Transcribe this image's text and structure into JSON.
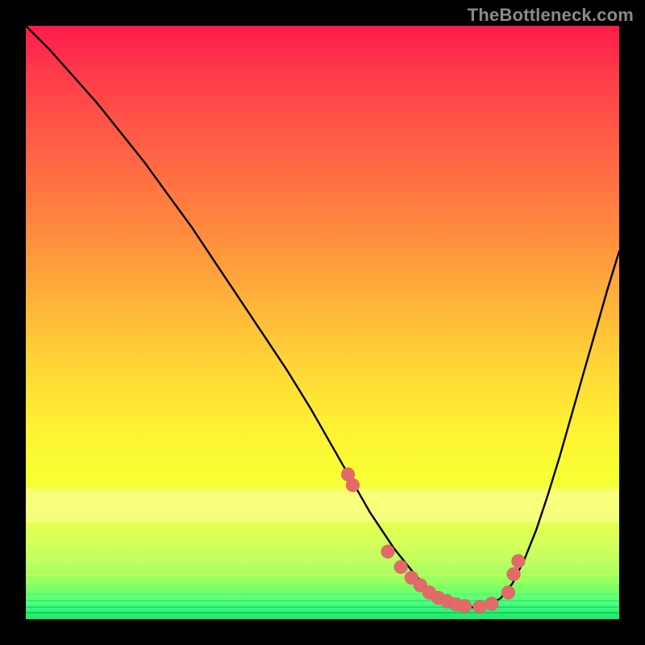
{
  "watermark": "TheBottleneck.com",
  "colors": {
    "background": "#000000",
    "curve": "#000000",
    "dot": "#e46a6a"
  },
  "chart_data": {
    "type": "line",
    "title": "",
    "xlabel": "",
    "ylabel": "",
    "xlim": [
      0,
      100
    ],
    "ylim": [
      0,
      100
    ],
    "grid": false,
    "legend": false,
    "series": [
      {
        "name": "bottleneck-curve",
        "x": [
          0,
          4,
          8,
          12,
          16,
          20,
          24,
          28,
          32,
          36,
          40,
          44,
          48,
          52,
          54,
          56,
          58,
          60,
          62,
          64,
          66,
          68,
          70,
          72,
          74,
          76,
          78,
          80,
          82,
          84,
          86,
          88,
          90,
          92,
          94,
          96,
          98,
          100
        ],
        "y": [
          100,
          96,
          91.5,
          87,
          82,
          77,
          71.5,
          66,
          60,
          54,
          48,
          42,
          35.5,
          28.5,
          25,
          21.5,
          18,
          15,
          12,
          9.5,
          7,
          5,
          3.5,
          2.5,
          2,
          2,
          2.5,
          3.5,
          6,
          10,
          15,
          21,
          27.5,
          34.5,
          41.5,
          48.5,
          55.5,
          62
        ]
      }
    ],
    "markers": {
      "name": "highlight-dots",
      "x": [
        54.3,
        55.1,
        61.0,
        63.2,
        65.0,
        66.5,
        68.0,
        69.5,
        71.0,
        72.5,
        74.0,
        76.5,
        78.5,
        81.3,
        82.2,
        83.0
      ],
      "y": [
        24.4,
        22.6,
        11.4,
        8.8,
        7.0,
        5.7,
        4.5,
        3.6,
        3.0,
        2.5,
        2.2,
        2.1,
        2.6,
        4.5,
        7.6,
        9.8
      ]
    }
  }
}
